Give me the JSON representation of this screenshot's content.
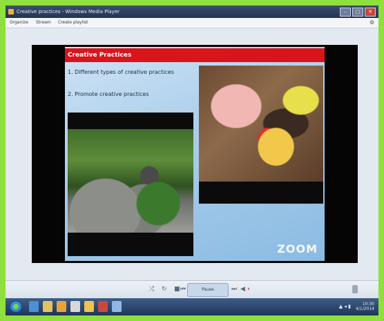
{
  "window": {
    "title": "Creative practices - Windows Media Player"
  },
  "menubar": {
    "items": [
      "Organize",
      "Stream",
      "Create playlist"
    ],
    "gear": "⚙"
  },
  "slide": {
    "header": "Creative Practices",
    "bullets": [
      "1. Different types of creative practices",
      "2. Promote creative practices"
    ],
    "watermark": "ZOOM"
  },
  "controls": {
    "shuffle": "⤮",
    "repeat": "↻",
    "stop": "■",
    "prev": "⏮",
    "play_label": "Pause",
    "next": "⏭",
    "mute": "◀",
    "next_arrow": "›"
  },
  "taskbar": {
    "tray_icons": "▲ ◂ ▮",
    "time": "10:30",
    "date": "4/1/2014"
  },
  "colors": {
    "accent": "#d9141b",
    "screen_border": "#8fe03c"
  }
}
